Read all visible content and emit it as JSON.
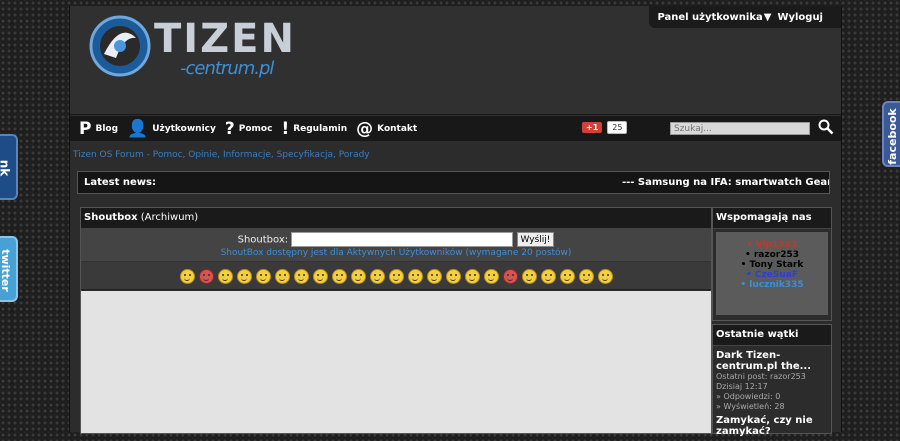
{
  "header": {
    "logo_main": "TIZEN",
    "logo_sub": "-centrum.pl",
    "user_panel": "Panel użytkownika",
    "logout": "Wyloguj"
  },
  "nav": {
    "items": [
      {
        "label": "Blog",
        "icon": "p-icon"
      },
      {
        "label": "Użytkownicy",
        "icon": "user-icon"
      },
      {
        "label": "Pomoc",
        "icon": "question-icon"
      },
      {
        "label": "Regulamin",
        "icon": "exclamation-icon"
      },
      {
        "label": "Kontakt",
        "icon": "at-icon"
      }
    ],
    "gplus_label": "+1",
    "gplus_count": "25",
    "search_placeholder": "Szukaj..."
  },
  "breadcrumb": "Tizen OS Forum - Pomoc, Opinie, Informacje, Specyfikacja, Porady",
  "news": {
    "label": "Latest news:",
    "ticker": "--- Samsung na IFA: smartwatch Gear, nov"
  },
  "shoutbox": {
    "title": "Shoutbox",
    "archive": "(Archiwum)",
    "field_label": "Shoutbox:",
    "send_label": "Wyślij!",
    "note": "ShoutBox dostępny jest dla Aktywnych Użytkowników (wymagane 20 postów)"
  },
  "supporters": {
    "title": "Wspomagają nas",
    "users": [
      {
        "name": "Vip1993",
        "color": "#c0392b"
      },
      {
        "name": "razor253",
        "color": "#000000"
      },
      {
        "name": "Tony Stark",
        "color": "#000000"
      },
      {
        "name": "CzeSuaF",
        "color": "#2a3fd6"
      },
      {
        "name": "lucznik335",
        "color": "#3c8fd8"
      }
    ]
  },
  "recent": {
    "title": "Ostatnie wątki",
    "threads": [
      {
        "title": "Dark Tizen-centrum.pl the...",
        "last_post": "Ostatni post: razor253",
        "date": "Dzisiaj 12:17",
        "replies": "» Odpowiedzi: 0",
        "views": "» Wyświetleń: 28"
      },
      {
        "title": "Zamykać, czy nie zamykać?",
        "last_post": "",
        "date": "",
        "replies": "",
        "views": ""
      }
    ]
  },
  "social": {
    "facebook": "facebook",
    "nk": "nk",
    "twitter": "twitter"
  }
}
